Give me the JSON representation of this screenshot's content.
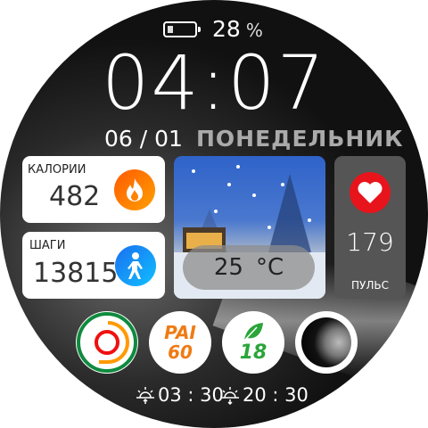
{
  "battery": {
    "percent": 28,
    "value": "28",
    "unit": "%"
  },
  "time": "04:07",
  "date": "06 / 01",
  "weekday": "ПОНЕДЕЛЬНИК",
  "calories": {
    "label": "КАЛОРИИ",
    "value": "482"
  },
  "steps": {
    "label": "ШАГИ",
    "value": "13815"
  },
  "weather": {
    "temp": "25",
    "unit": "°C"
  },
  "pulse": {
    "value": "179",
    "label": "ПУЛЬС"
  },
  "pai": {
    "label": "PAI",
    "value": "60"
  },
  "eco": {
    "value": "18"
  },
  "sunrise": "03 : 30",
  "sunset": "20 : 30",
  "colors": {
    "flame": "#ff7a00",
    "walk": "#1e8ef0",
    "heart": "#e8141c",
    "pai": "#f07b12",
    "leaf": "#2aa53a"
  }
}
